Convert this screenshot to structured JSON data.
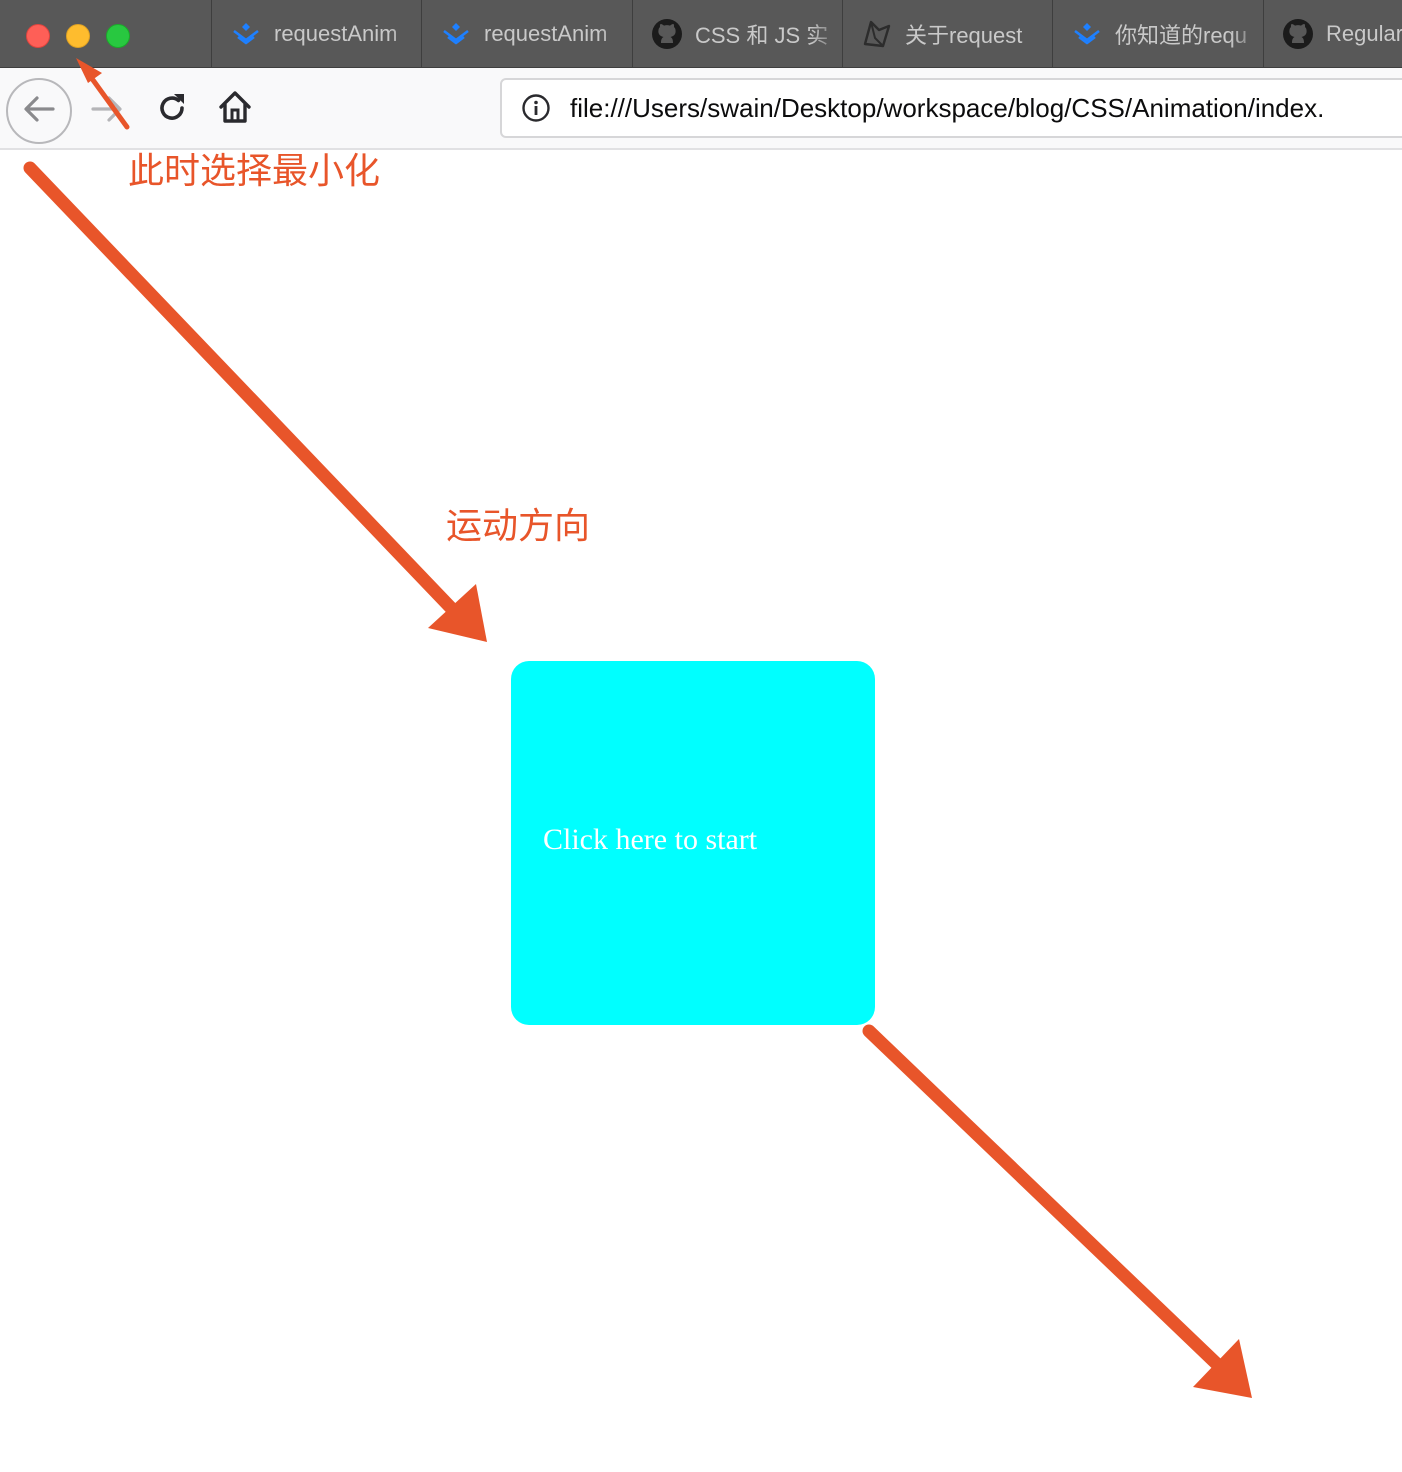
{
  "window": {
    "controls": [
      "close",
      "minimize",
      "maximize"
    ]
  },
  "tabs": [
    {
      "label": "requestAnim",
      "icon": "juejin-icon"
    },
    {
      "label": "requestAnim",
      "icon": "juejin-icon"
    },
    {
      "label": "CSS 和 JS 实",
      "icon": "github-icon"
    },
    {
      "label": "关于request",
      "icon": "segmentfault-icon"
    },
    {
      "label": "你知道的requ",
      "icon": "juejin-icon"
    },
    {
      "label": "Regular",
      "icon": "github-icon"
    }
  ],
  "urlbar": {
    "url": "file:///Users/swain/Desktop/workspace/blog/CSS/Animation/index."
  },
  "page": {
    "box_label": "Click here to start",
    "box_color": "#00ffff"
  },
  "annotations": {
    "minimize_note": "此时选择最小化",
    "direction_note": "运动方向",
    "color": "#e8552a"
  },
  "colors": {
    "tab_bar": "#585858",
    "nav_bar": "#f9f9fa",
    "close": "#fe5f57",
    "minimize": "#febc2e",
    "maximize": "#28c840",
    "juejin_blue": "#1e80ff"
  }
}
